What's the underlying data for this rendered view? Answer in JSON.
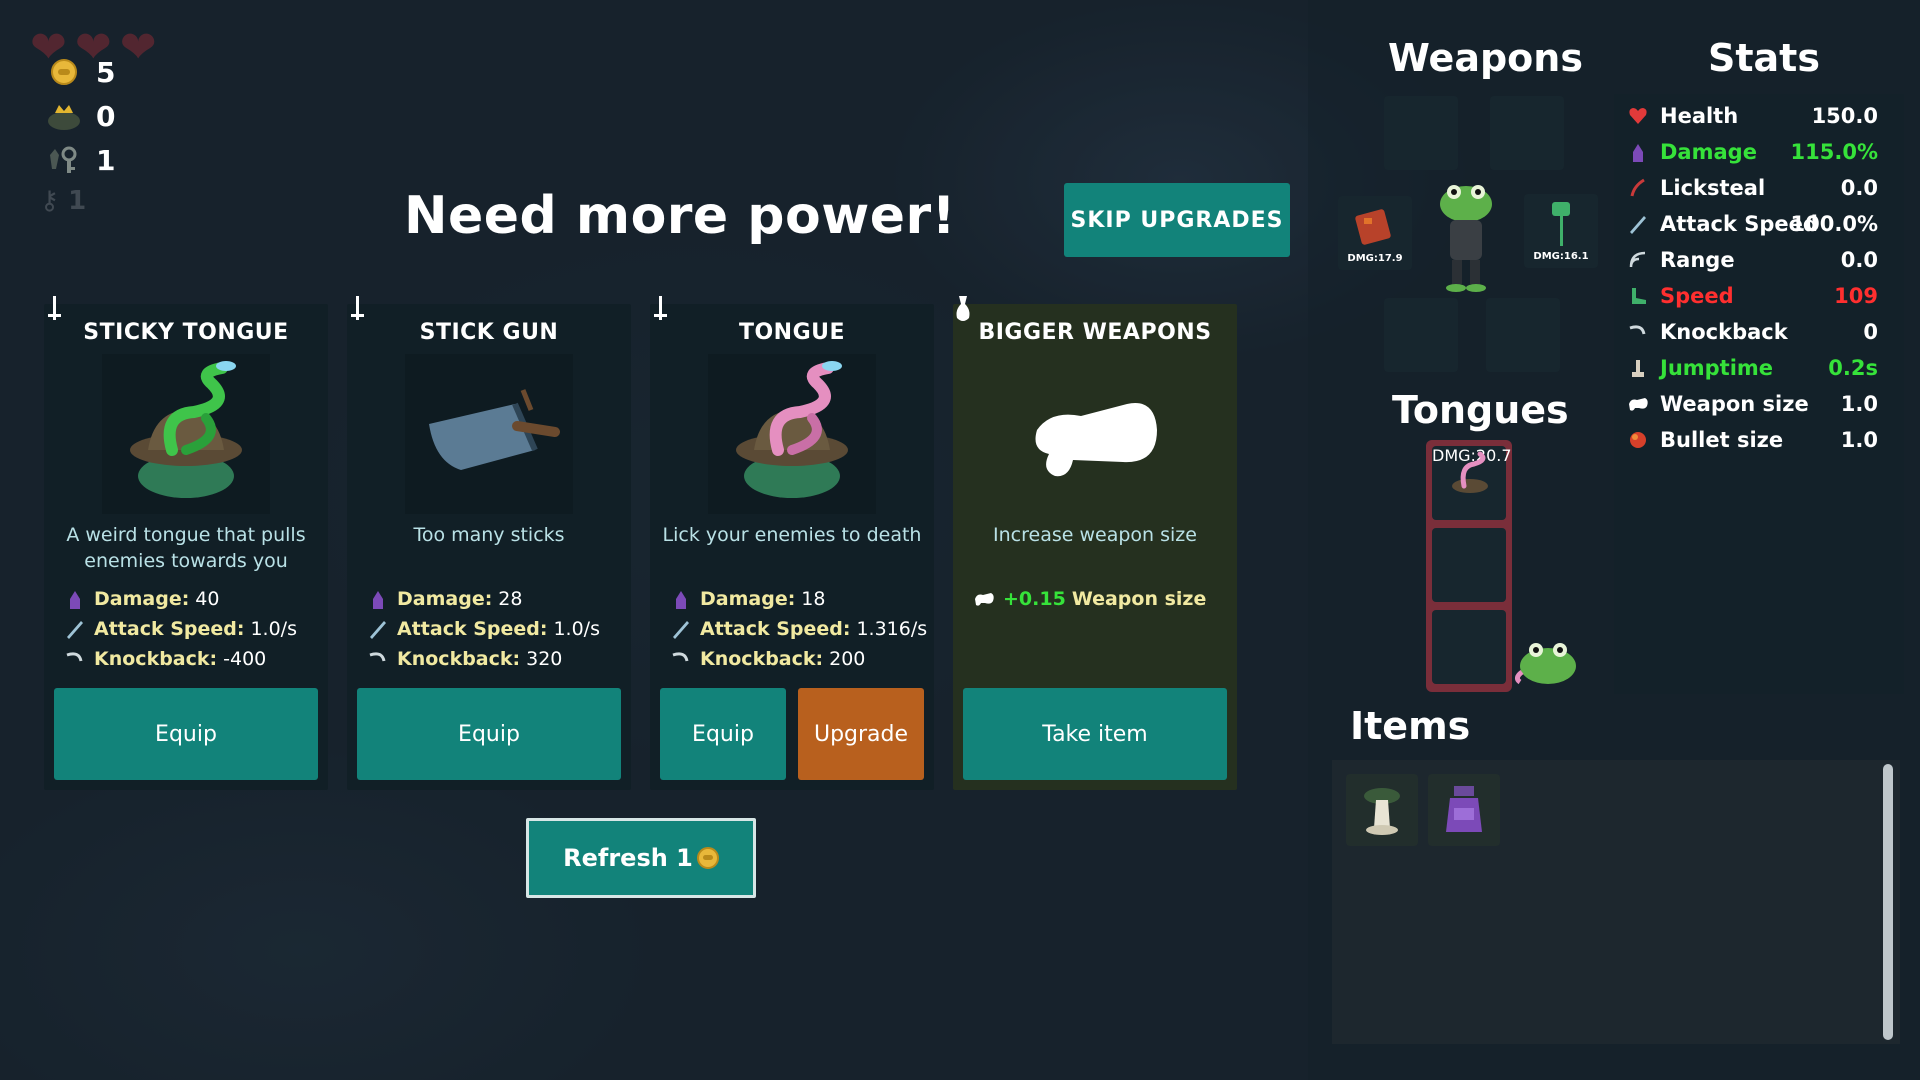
{
  "currency": {
    "coins": "5",
    "crowns": "0",
    "keys": "1",
    "ghost_count": "1"
  },
  "headline": "Need more power!",
  "skip_button": "SKIP UPGRADES",
  "refresh_button": "Refresh 1",
  "cards": [
    {
      "title": "STICKY TONGUE",
      "description": "A weird tongue that pulls enemies towards you",
      "stats": [
        {
          "label": "Damage:",
          "value": "40"
        },
        {
          "label": "Attack Speed:",
          "value": "1.0/s"
        },
        {
          "label": "Knockback:",
          "value": "-400"
        }
      ],
      "buttons": [
        "Equip"
      ]
    },
    {
      "title": "STICK GUN",
      "description": "Too many sticks",
      "stats": [
        {
          "label": "Damage:",
          "value": "28"
        },
        {
          "label": "Attack Speed:",
          "value": "1.0/s"
        },
        {
          "label": "Knockback:",
          "value": "320"
        }
      ],
      "buttons": [
        "Equip"
      ]
    },
    {
      "title": "TONGUE",
      "description": "Lick your enemies to death",
      "stats": [
        {
          "label": "Damage:",
          "value": "18"
        },
        {
          "label": "Attack Speed:",
          "value": "1.316/s"
        },
        {
          "label": "Knockback:",
          "value": "200"
        }
      ],
      "buttons": [
        "Equip",
        "Upgrade"
      ]
    },
    {
      "title": "BIGGER WEAPONS",
      "description": "Increase weapon size",
      "stats": [
        {
          "label": "+0.15",
          "value": "Weapon size"
        }
      ],
      "buttons": [
        "Take item"
      ]
    }
  ],
  "right_panel": {
    "weapons_title": "Weapons",
    "stats_title": "Stats",
    "tongues_title": "Tongues",
    "items_title": "Items",
    "weapon_slots": [
      {
        "dmg": ""
      },
      {
        "dmg": ""
      },
      {
        "dmg": "DMG:17.9"
      },
      {
        "dmg": "DMG:16.1"
      },
      {
        "dmg": ""
      },
      {
        "dmg": ""
      }
    ],
    "tongue_slots": [
      {
        "dmg": "DMG:20.7"
      },
      {
        "dmg": ""
      },
      {
        "dmg": ""
      }
    ],
    "stats": [
      {
        "label": "Health",
        "value": "150.0",
        "color": "#ffffff",
        "icon": "heart-icon"
      },
      {
        "label": "Damage",
        "value": "115.0%",
        "color": "#36e23a",
        "icon": "damage-icon"
      },
      {
        "label": "Licksteal",
        "value": "0.0",
        "color": "#ffffff",
        "icon": "licksteal-icon"
      },
      {
        "label": "Attack Speed",
        "value": "100.0%",
        "color": "#ffffff",
        "icon": "attack-speed-icon"
      },
      {
        "label": "Range",
        "value": "0.0",
        "color": "#ffffff",
        "icon": "range-icon"
      },
      {
        "label": "Speed",
        "value": "109",
        "color": "#ff2f2f",
        "icon": "speed-icon"
      },
      {
        "label": "Knockback",
        "value": "0",
        "color": "#ffffff",
        "icon": "knockback-icon"
      },
      {
        "label": "Jumptime",
        "value": "0.2s",
        "color": "#36e23a",
        "icon": "jumptime-icon"
      },
      {
        "label": "Weapon size",
        "value": "1.0",
        "color": "#ffffff",
        "icon": "weapon-size-icon"
      },
      {
        "label": "Bullet size",
        "value": "1.0",
        "color": "#ffffff",
        "icon": "bullet-size-icon"
      }
    ],
    "items": [
      "mushroom-item-icon",
      "potion-item-icon"
    ]
  },
  "colors": {
    "teal": "#12837a",
    "orange": "#b8601e",
    "stat_label": "#f1e9a1",
    "desc": "#b9e1e6",
    "green_value": "#36e23a"
  }
}
